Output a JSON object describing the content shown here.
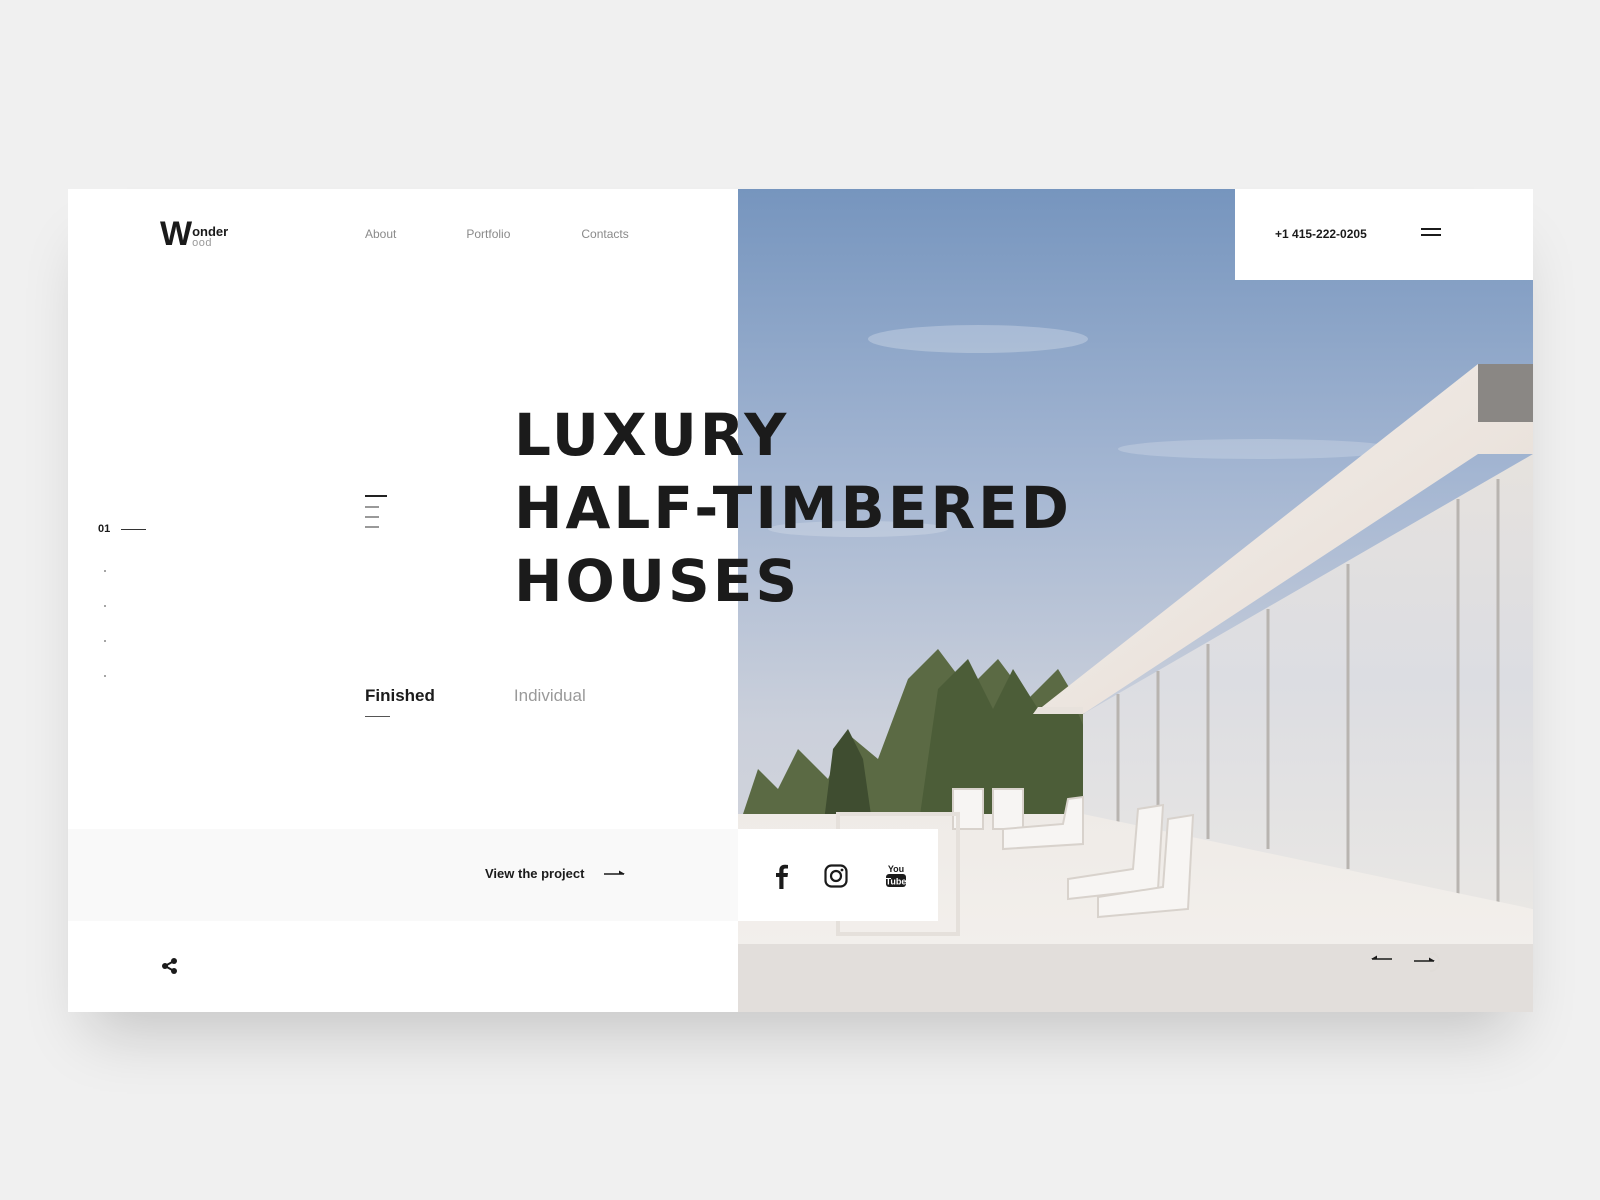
{
  "brand": {
    "logo_letter": "W",
    "logo_top": "onder",
    "logo_bottom": "ood"
  },
  "nav": {
    "items": [
      {
        "label": "About"
      },
      {
        "label": "Portfolio"
      },
      {
        "label": "Contacts"
      }
    ]
  },
  "header": {
    "phone": "+1 415-222-0205",
    "menu_icon": "hamburger-menu-icon"
  },
  "slider": {
    "current": "01",
    "total_dots": 4,
    "prev_icon": "arrow-left-icon",
    "next_icon": "arrow-right-icon"
  },
  "hero": {
    "title": "LUXURY\nHALF-TIMBERED\nHOUSES",
    "list_icon": "list-lines-icon"
  },
  "tabs": [
    {
      "label": "Finished",
      "active": true
    },
    {
      "label": "Individual",
      "active": false
    }
  ],
  "cta": {
    "label": "View the project",
    "icon": "arrow-right-icon"
  },
  "social": [
    {
      "name": "facebook-icon"
    },
    {
      "name": "instagram-icon"
    },
    {
      "name": "youtube-icon",
      "text_top": "You",
      "text_bottom": "Tube"
    }
  ],
  "share": {
    "icon": "share-icon"
  },
  "colors": {
    "page_bg": "#f0f0f0",
    "card_bg": "#ffffff",
    "text_dark": "#1b1b1b",
    "text_muted": "#8a8a8a",
    "band_bg": "#f9f9f9",
    "sky_top": "#7a98c0",
    "sky_bottom": "#cfd3dc"
  }
}
